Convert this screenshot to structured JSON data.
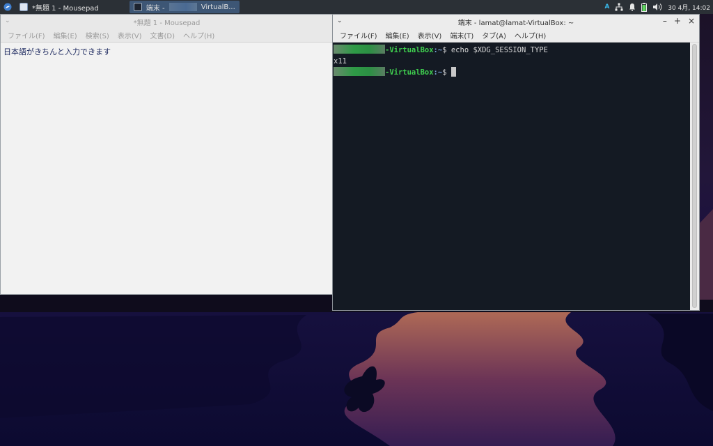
{
  "panel": {
    "tasks": [
      {
        "label": "*無題 1 - Mousepad"
      },
      {
        "label_prefix": "端末 -",
        "label_suffix": "VirtualB..."
      }
    ],
    "indicator": "A",
    "clock": "30 4月, 14:02"
  },
  "mousepad": {
    "title": "*無題 1 - Mousepad",
    "menu": [
      "ファイル(F)",
      "編集(E)",
      "検索(S)",
      "表示(V)",
      "文書(D)",
      "ヘルプ(H)"
    ],
    "content": "日本語がきちんと入力できます"
  },
  "terminal": {
    "title": "端末 - lamat@lamat-VirtualBox: ~",
    "menu": [
      "ファイル(F)",
      "編集(E)",
      "表示(V)",
      "端末(T)",
      "タブ(A)",
      "ヘルプ(H)"
    ],
    "host_suffix": "-VirtualBox",
    "path": ":~",
    "prompt": "$",
    "command": "echo $XDG_SESSION_TYPE",
    "output": "x11"
  },
  "colors": {
    "panel_bg": "#2b3036",
    "terminal_bg": "#141a23",
    "prompt_host": "#3fd04f",
    "active_task": "#3d5675"
  }
}
